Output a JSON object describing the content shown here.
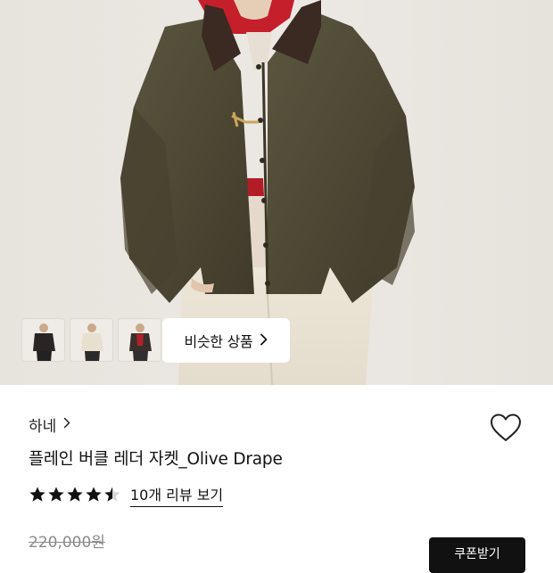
{
  "gallery": {
    "similar_button_label": "비슷한 상품",
    "thumbnails": [
      "thumbnail-black-jacket",
      "thumbnail-cream-jacket",
      "thumbnail-dark-jacket"
    ]
  },
  "product": {
    "brand": "하네",
    "title": "플레인 버클 레더 자켓_Olive Drape",
    "rating": 4.5,
    "rating_max": 5,
    "review_link_label": "10개 리뷰 보기",
    "original_price": "220,000원"
  },
  "actions": {
    "coupon_button_label": "쿠폰받기"
  },
  "colors": {
    "accent": "#111111",
    "jacket": "#4f4a35",
    "collar": "#3a2a22",
    "hood": "#c41f2a"
  },
  "icons": {
    "wishlist": "heart-outline-icon",
    "chevron": "chevron-right-icon",
    "star": "star-icon"
  }
}
